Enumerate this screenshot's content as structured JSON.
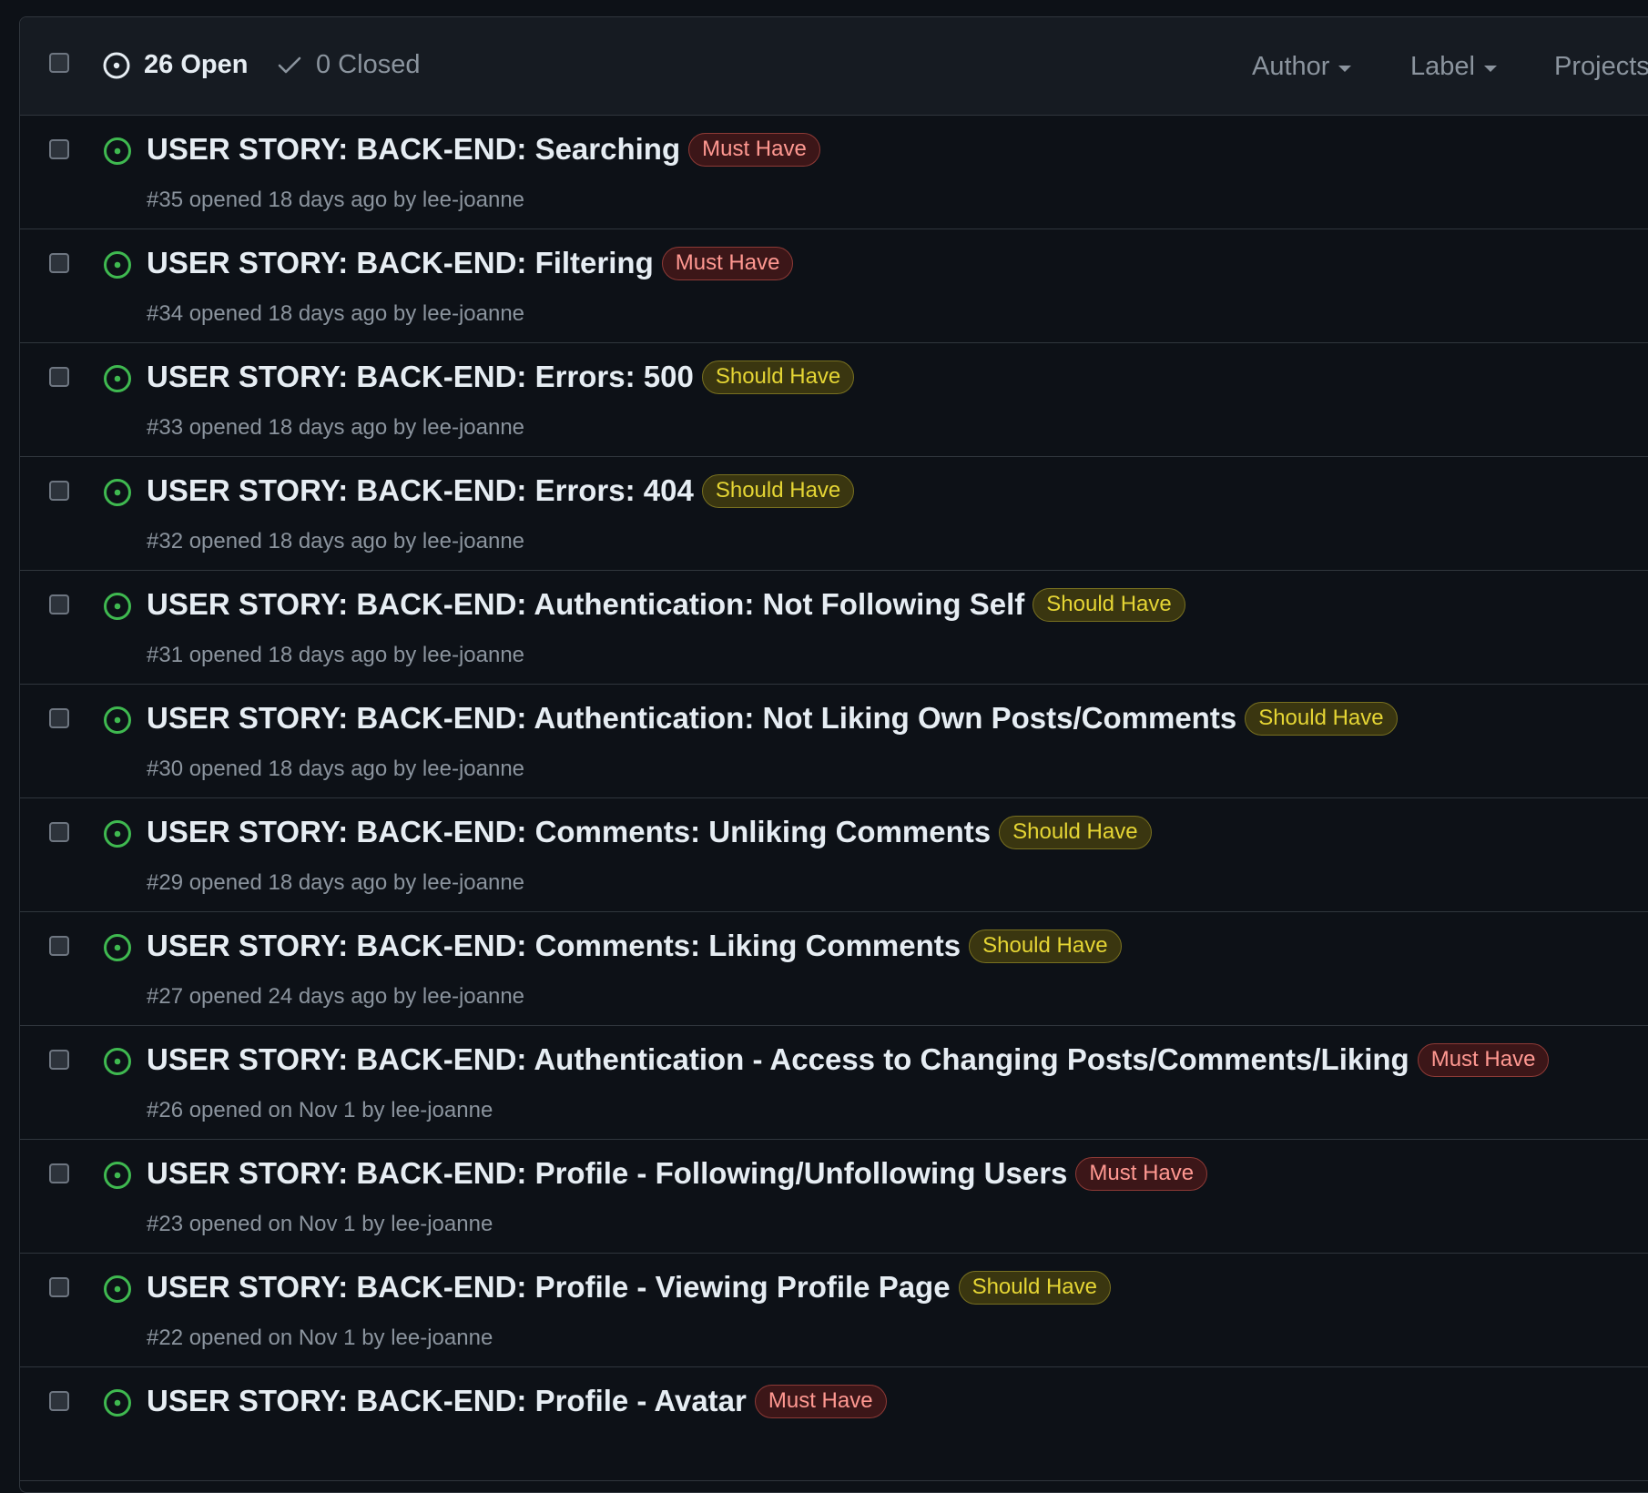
{
  "header": {
    "open_label": "26 Open",
    "closed_label": "0 Closed",
    "filters": [
      "Author",
      "Label",
      "Projects"
    ]
  },
  "colors": {
    "open_icon": "#3fb950",
    "must_have_text": "#ff9891",
    "should_have_text": "#e5d534"
  },
  "issues": [
    {
      "title": "USER STORY: BACK-END: Searching",
      "label": "Must Have",
      "label_type": "must",
      "meta": "#35 opened 18 days ago by lee-joanne"
    },
    {
      "title": "USER STORY: BACK-END: Filtering",
      "label": "Must Have",
      "label_type": "must",
      "meta": "#34 opened 18 days ago by lee-joanne"
    },
    {
      "title": "USER STORY: BACK-END: Errors: 500",
      "label": "Should Have",
      "label_type": "should",
      "meta": "#33 opened 18 days ago by lee-joanne"
    },
    {
      "title": "USER STORY: BACK-END: Errors: 404",
      "label": "Should Have",
      "label_type": "should",
      "meta": "#32 opened 18 days ago by lee-joanne"
    },
    {
      "title": "USER STORY: BACK-END: Authentication: Not Following Self",
      "label": "Should Have",
      "label_type": "should",
      "meta": "#31 opened 18 days ago by lee-joanne"
    },
    {
      "title": "USER STORY: BACK-END: Authentication: Not Liking Own Posts/Comments",
      "label": "Should Have",
      "label_type": "should",
      "meta": "#30 opened 18 days ago by lee-joanne"
    },
    {
      "title": "USER STORY: BACK-END: Comments: Unliking Comments",
      "label": "Should Have",
      "label_type": "should",
      "meta": "#29 opened 18 days ago by lee-joanne"
    },
    {
      "title": "USER STORY: BACK-END: Comments: Liking Comments",
      "label": "Should Have",
      "label_type": "should",
      "meta": "#27 opened 24 days ago by lee-joanne"
    },
    {
      "title": "USER STORY: BACK-END: Authentication - Access to Changing Posts/Comments/Liking",
      "label": "Must Have",
      "label_type": "must",
      "meta": "#26 opened on Nov 1 by lee-joanne"
    },
    {
      "title": "USER STORY: BACK-END: Profile - Following/Unfollowing Users",
      "label": "Must Have",
      "label_type": "must",
      "meta": "#23 opened on Nov 1 by lee-joanne"
    },
    {
      "title": "USER STORY: BACK-END: Profile - Viewing Profile Page",
      "label": "Should Have",
      "label_type": "should",
      "meta": "#22 opened on Nov 1 by lee-joanne"
    },
    {
      "title": "USER STORY: BACK-END: Profile - Avatar",
      "label": "Must Have",
      "label_type": "must",
      "meta": ""
    }
  ]
}
